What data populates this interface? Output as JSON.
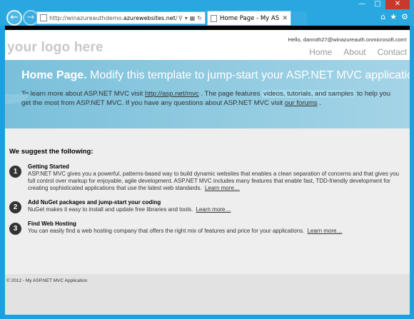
{
  "browser": {
    "address_prefix": "http://winazureauthdemo.",
    "address_domain": "azurewebsites.net",
    "address_suffix": "/",
    "tab_title": "Home Page - My ASP.NET ...",
    "icons": [
      "back-icon",
      "forward-icon",
      "search-icon",
      "refresh-icon",
      "home-icon",
      "favorites-icon",
      "settings-icon"
    ]
  },
  "site": {
    "logo": "your logo here",
    "hello_text": "Hello, danroth27@winazureauth.onmicrosoft.com!",
    "nav": [
      "Home",
      "About",
      "Contact"
    ]
  },
  "featured": {
    "title_bold": "Home Page.",
    "title_rest": " Modify this template to jump-start your ASP.NET MVC application.",
    "p1": "To learn more about ASP.NET MVC visit ",
    "link1": "http://asp.net/mvc",
    "p2": " . The page features ",
    "mark": "videos, tutorials, and samples",
    "p3": " to help you get the most from ASP.NET MVC. If you have any questions about ASP.NET MVC visit ",
    "link2": "our forums",
    "p4": " ."
  },
  "main": {
    "heading": "We suggest the following:",
    "steps": [
      {
        "num": "1",
        "title": "Getting Started",
        "text": "ASP.NET MVC gives you a powerful, patterns-based way to build dynamic websites that enables a clean separation of concerns and that gives you full control over markup for enjoyable, agile development. ASP.NET MVC includes many features that enable fast, TDD-friendly development for creating sophisticated applications that use the latest web standards.",
        "link": "Learn more…"
      },
      {
        "num": "2",
        "title": "Add NuGet packages and jump-start your coding",
        "text": "NuGet makes it easy to install and update free libraries and tools.",
        "link": "Learn more…"
      },
      {
        "num": "3",
        "title": "Find Web Hosting",
        "text": "You can easily find a web hosting company that offers the right mix of features and price for your applications.",
        "link": "Learn more…"
      }
    ]
  },
  "footer": {
    "text": "© 2012 - My ASP.NET MVC Application"
  },
  "colors": {
    "featured_start": "#7ac0da",
    "featured_end": "#a4d4e6",
    "window_chrome": "#29a8e0",
    "close_button": "#c7392c"
  }
}
